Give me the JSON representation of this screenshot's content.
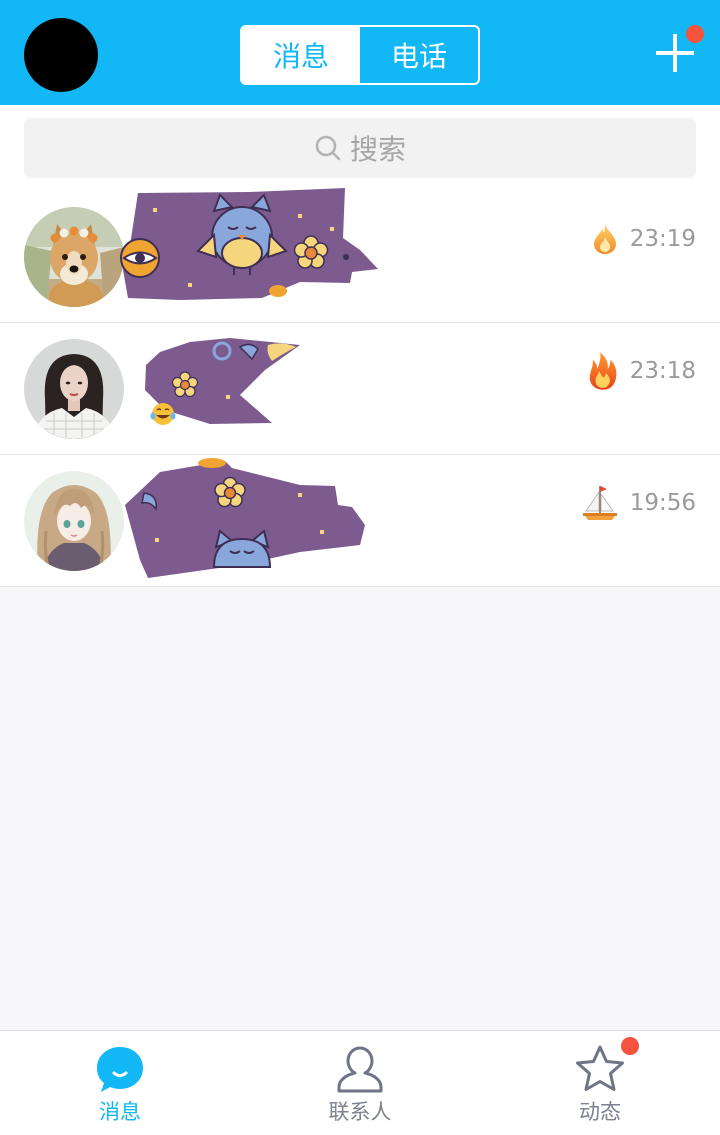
{
  "colors": {
    "accent": "#12B7F5",
    "badge": "#F5533D",
    "sticker": "#7D5B8E",
    "inactive_icon": "#6f7486"
  },
  "header": {
    "tabs": [
      {
        "label": "消息",
        "active": true
      },
      {
        "label": "电话",
        "active": false
      }
    ],
    "add_icon": "plus-icon",
    "add_has_notification": true
  },
  "search": {
    "placeholder": "搜索",
    "icon": "search-icon"
  },
  "conversations": [
    {
      "time": "23:19",
      "badge_icon": "flame-icon"
    },
    {
      "time": "23:18",
      "badge_icon": "fire-icon"
    },
    {
      "time": "19:56",
      "badge_icon": "sailboat-icon"
    }
  ],
  "bottom_nav": {
    "items": [
      {
        "label": "消息",
        "icon": "chat-bubble-icon",
        "active": true,
        "notification": false
      },
      {
        "label": "联系人",
        "icon": "person-icon",
        "active": false,
        "notification": false
      },
      {
        "label": "动态",
        "icon": "star-icon",
        "active": false,
        "notification": true
      }
    ]
  }
}
